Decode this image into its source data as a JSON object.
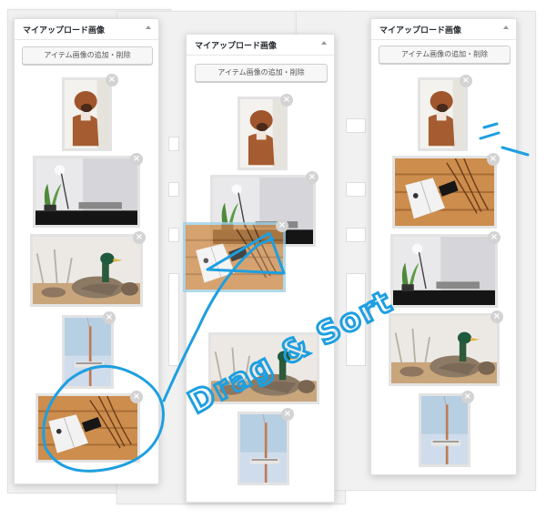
{
  "panels": [
    {
      "title": "マイアップロード画像",
      "add_button": "アイテム画像の追加・削除",
      "thumbs": [
        "dog",
        "desk",
        "duck",
        "tower",
        "book"
      ]
    },
    {
      "title": "マイアップロード画像",
      "add_button": "アイテム画像の追加・削除",
      "thumbs": [
        "dog",
        "desk",
        "book",
        "duck",
        "tower"
      ]
    },
    {
      "title": "マイアップロード画像",
      "add_button": "アイテム画像の追加・削除",
      "thumbs": [
        "dog",
        "book",
        "desk",
        "duck",
        "tower"
      ]
    }
  ],
  "remove_symbol": "×",
  "annotation": {
    "text": "Drag & Sort"
  },
  "colors": {
    "annotation": "#1e9fe0",
    "thumb_border": "#e3e3e3"
  }
}
